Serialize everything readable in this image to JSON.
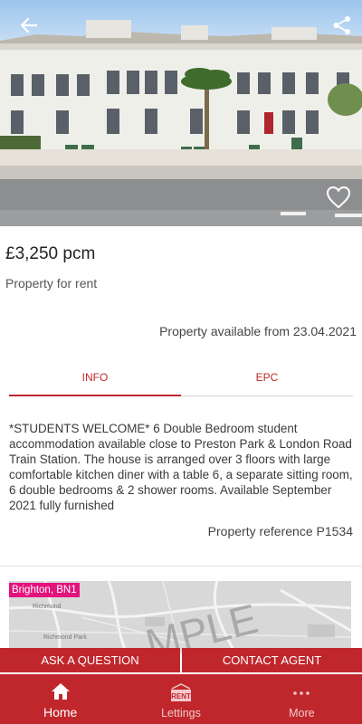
{
  "listing": {
    "price": "£3,250 pcm",
    "type": "Property for rent",
    "availability": "Property available from 23.04.2021",
    "description": "*STUDENTS WELCOME* 6 Double Bedroom student accommodation available close to Preston Park & London Road Train Station. The house is arranged over 3 floors with large comfortable kitchen diner with a table 6, a separate sitting room, 6 double bedrooms & 2 shower rooms. Available September 2021 fully furnished",
    "reference": "Property reference P1534"
  },
  "tabs": [
    {
      "label": "INFO",
      "active": true
    },
    {
      "label": "EPC",
      "active": false
    }
  ],
  "map": {
    "badge": "Brighton, BN1",
    "watermark": "MPLE",
    "labels": [
      "Richmond",
      "Richmond Park"
    ]
  },
  "actions": {
    "ask": "ASK A QUESTION",
    "contact": "CONTACT AGENT"
  },
  "nav": {
    "home": "Home",
    "lettings": "Lettings",
    "lettings_icon_text": "RENT",
    "more": "More"
  },
  "colors": {
    "brand": "#c0272d",
    "badge": "#e4127d"
  },
  "icons": {
    "back": "arrow-left-icon",
    "share": "share-icon",
    "favourite": "heart-outline-icon",
    "home": "home-icon",
    "lettings": "rent-sign-icon",
    "more": "more-dots-icon"
  }
}
